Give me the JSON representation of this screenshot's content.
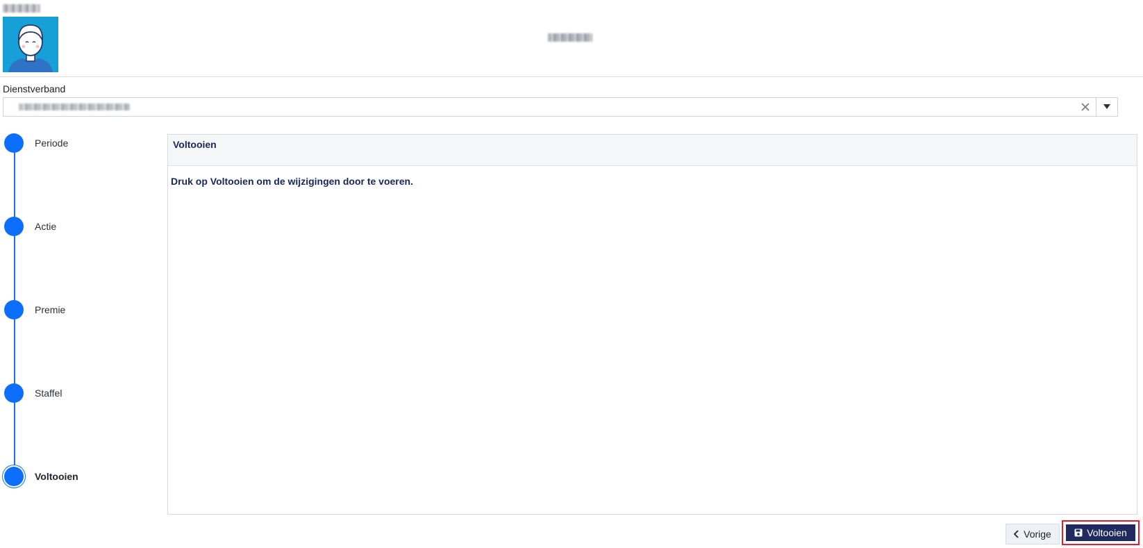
{
  "header": {
    "avatar_icon": "user-avatar-icon"
  },
  "form": {
    "employment_label": "Dienstverband",
    "clear_icon": "close-icon",
    "dropdown_icon": "triangle-down-icon"
  },
  "stepper": {
    "steps": [
      {
        "label": "Periode",
        "active": false
      },
      {
        "label": "Actie",
        "active": false
      },
      {
        "label": "Premie",
        "active": false
      },
      {
        "label": "Staffel",
        "active": false
      },
      {
        "label": "Voltooien",
        "active": true
      }
    ]
  },
  "panel": {
    "title": "Voltooien",
    "message": "Druk op Voltooien om de wijzigingen door te voeren."
  },
  "footer": {
    "prev_label": "Vorige",
    "finish_label": "Voltooien",
    "prev_icon": "chevron-left-icon",
    "finish_icon": "save-icon"
  },
  "colors": {
    "accent": "#0d6efd",
    "primary_dark": "#1f2a5e",
    "highlight": "#e11d2f"
  }
}
